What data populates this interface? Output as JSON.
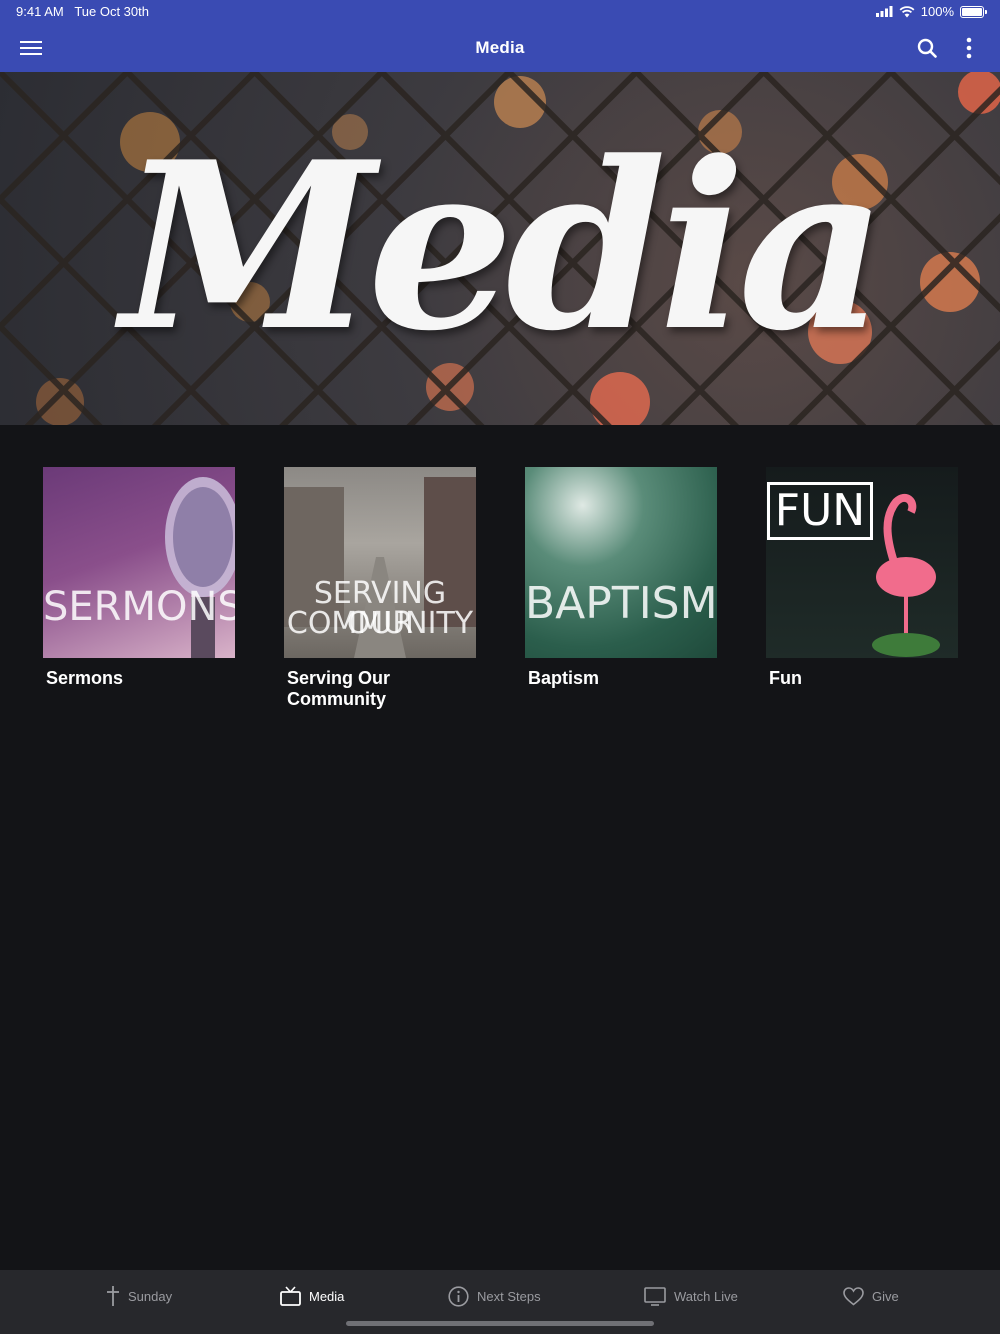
{
  "status": {
    "time": "9:41 AM",
    "date": "Tue Oct 30th",
    "battery": "100%"
  },
  "header": {
    "title": "Media",
    "color": "#3a4bb3"
  },
  "hero": {
    "text": "Media"
  },
  "categories": [
    {
      "label": "Sermons",
      "image_text": "SERMONS"
    },
    {
      "label": "Serving Our Community",
      "image_text_line1": "SERVING OUR",
      "image_text_line2": "COMMUNITY"
    },
    {
      "label": "Baptism",
      "image_text": "BAPTISM"
    },
    {
      "label": "Fun",
      "image_text": "FUN"
    }
  ],
  "tabs": [
    {
      "label": "Sunday",
      "icon": "cross-icon"
    },
    {
      "label": "Media",
      "icon": "tv-icon",
      "active": true
    },
    {
      "label": "Next Steps",
      "icon": "info-icon"
    },
    {
      "label": "Watch Live",
      "icon": "monitor-icon"
    },
    {
      "label": "Give",
      "icon": "heart-icon"
    }
  ]
}
